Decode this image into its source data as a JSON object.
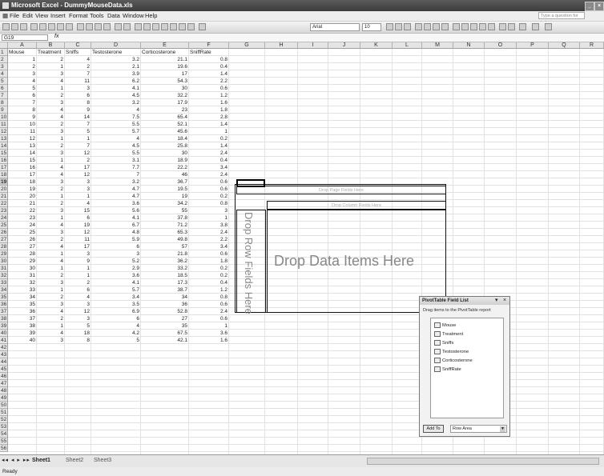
{
  "window": {
    "title": "Microsoft Excel - DummyMouseData.xls"
  },
  "menu": {
    "items": [
      "File",
      "Edit",
      "View",
      "Insert",
      "Format",
      "Tools",
      "Data",
      "Window",
      "Help"
    ],
    "help_placeholder": "Type a question for help"
  },
  "toolbar": {
    "font_name": "Arial",
    "font_size": "10"
  },
  "formula_bar": {
    "name_box": "G19",
    "fx": "fx"
  },
  "grid": {
    "columns": [
      "A",
      "B",
      "C",
      "D",
      "E",
      "F",
      "G",
      "H",
      "I",
      "J",
      "K",
      "L",
      "M",
      "N",
      "O",
      "P",
      "Q",
      "R"
    ],
    "row_numbers": [
      "1",
      "2",
      "3",
      "4",
      "5",
      "6",
      "7",
      "8",
      "9",
      "10",
      "11",
      "12",
      "13",
      "14",
      "15",
      "16",
      "17",
      "18",
      "19",
      "20",
      "21",
      "22",
      "23",
      "24",
      "25",
      "26",
      "27",
      "28",
      "29",
      "30",
      "31",
      "32",
      "33",
      "34",
      "35",
      "36",
      "37",
      "38",
      "39",
      "40",
      "41",
      "42",
      "43",
      "44",
      "45",
      "46",
      "47",
      "48",
      "49",
      "50",
      "51",
      "52",
      "53",
      "54",
      "55",
      "56"
    ],
    "selected_row": "19",
    "headers": [
      "Mouse",
      "Treatment",
      "Sniffs",
      "Testosterone",
      "Corticosterone",
      "SniffRate"
    ],
    "rows": [
      [
        "1",
        "2",
        "4",
        "3.2",
        "21.1",
        "0.8"
      ],
      [
        "2",
        "1",
        "2",
        "2.1",
        "19.6",
        "0.4"
      ],
      [
        "3",
        "3",
        "7",
        "3.9",
        "17",
        "1.4"
      ],
      [
        "4",
        "4",
        "11",
        "6.2",
        "54.3",
        "2.2"
      ],
      [
        "5",
        "1",
        "3",
        "4.1",
        "30",
        "0.6"
      ],
      [
        "6",
        "2",
        "6",
        "4.5",
        "32.2",
        "1.2"
      ],
      [
        "7",
        "3",
        "8",
        "3.2",
        "17.9",
        "1.6"
      ],
      [
        "8",
        "4",
        "9",
        "4",
        "23",
        "1.8"
      ],
      [
        "9",
        "4",
        "14",
        "7.5",
        "65.4",
        "2.8"
      ],
      [
        "10",
        "2",
        "7",
        "5.5",
        "52.1",
        "1.4"
      ],
      [
        "11",
        "3",
        "5",
        "5.7",
        "45.6",
        "1"
      ],
      [
        "12",
        "1",
        "1",
        "4",
        "18.4",
        "0.2"
      ],
      [
        "13",
        "2",
        "7",
        "4.5",
        "25.8",
        "1.4"
      ],
      [
        "14",
        "3",
        "12",
        "5.5",
        "30",
        "2.4"
      ],
      [
        "15",
        "1",
        "2",
        "3.1",
        "18.9",
        "0.4"
      ],
      [
        "16",
        "4",
        "17",
        "7.7",
        "22.2",
        "3.4"
      ],
      [
        "17",
        "4",
        "12",
        "7",
        "46",
        "2.4"
      ],
      [
        "18",
        "3",
        "3",
        "3.2",
        "36.7",
        "0.6"
      ],
      [
        "19",
        "2",
        "3",
        "4.7",
        "19.5",
        "0.6"
      ],
      [
        "20",
        "1",
        "1",
        "4.7",
        "19",
        "0.2"
      ],
      [
        "21",
        "2",
        "4",
        "3.6",
        "34.2",
        "0.8"
      ],
      [
        "22",
        "3",
        "15",
        "5.6",
        "55",
        "3"
      ],
      [
        "23",
        "1",
        "6",
        "4.1",
        "37.8",
        "1"
      ],
      [
        "24",
        "4",
        "19",
        "6.7",
        "71.2",
        "3.8"
      ],
      [
        "25",
        "3",
        "12",
        "4.8",
        "65.3",
        "2.4"
      ],
      [
        "26",
        "2",
        "11",
        "5.9",
        "49.8",
        "2.2"
      ],
      [
        "27",
        "4",
        "17",
        "6",
        "57",
        "3.4"
      ],
      [
        "28",
        "1",
        "3",
        "3",
        "21.8",
        "0.6"
      ],
      [
        "29",
        "4",
        "9",
        "5.2",
        "36.2",
        "1.8"
      ],
      [
        "30",
        "1",
        "1",
        "2.9",
        "33.2",
        "0.2"
      ],
      [
        "31",
        "2",
        "1",
        "3.6",
        "18.5",
        "0.2"
      ],
      [
        "32",
        "3",
        "2",
        "4.1",
        "17.3",
        "0.4"
      ],
      [
        "33",
        "1",
        "6",
        "5.7",
        "38.7",
        "1.2"
      ],
      [
        "34",
        "2",
        "4",
        "3.4",
        "34",
        "0.8"
      ],
      [
        "35",
        "3",
        "3",
        "3.5",
        "36",
        "0.6"
      ],
      [
        "36",
        "4",
        "12",
        "6.9",
        "52.8",
        "2.4"
      ],
      [
        "37",
        "2",
        "3",
        "6",
        "27",
        "0.6"
      ],
      [
        "38",
        "1",
        "5",
        "4",
        "35",
        "1"
      ],
      [
        "39",
        "4",
        "18",
        "4.2",
        "67.5",
        "3.6"
      ],
      [
        "40",
        "3",
        "8",
        "5",
        "42.1",
        "1.6"
      ]
    ]
  },
  "pivot": {
    "page_fields": "Drop Page Fields Here",
    "column_fields": "Drop Column Fields Here",
    "row_fields": "Drop Row Fields Here",
    "data_items": "Drop Data Items Here"
  },
  "field_list": {
    "title": "PivotTable Field List",
    "description": "Drag items to the PivotTable report",
    "fields": [
      "Mouse",
      "Treatment",
      "Sniffs",
      "Testosterone",
      "Corticosterone",
      "SniffRate"
    ],
    "add_to": "Add To",
    "area": "Row Area"
  },
  "sheets": {
    "tabs": [
      "Sheet1",
      "Sheet2",
      "Sheet3"
    ]
  },
  "status": {
    "text": "Ready"
  }
}
